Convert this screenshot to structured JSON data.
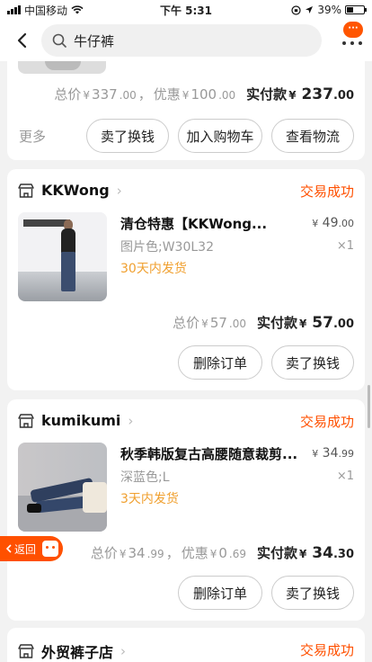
{
  "status_bar": {
    "carrier": "中国移动",
    "time": "下午 5:31",
    "battery": "39%"
  },
  "search": {
    "query": "牛仔裤"
  },
  "order1": {
    "summary": {
      "total_label": "总价",
      "currency": "¥",
      "total_int": "337",
      "total_dec": ".00",
      "discount_label": "优惠",
      "discount_int": "100",
      "discount_dec": ".00",
      "pay_label": "实付款",
      "pay_int": "237",
      "pay_dec": ".00"
    },
    "more": "更多",
    "buttons": {
      "sell": "卖了换钱",
      "cart": "加入购物车",
      "logistics": "查看物流"
    }
  },
  "order2": {
    "shop": "KKWong",
    "status": "交易成功",
    "item": {
      "title": "清仓特惠【KKWong...",
      "price_int": "49",
      "price_dec": ".00",
      "spec": "图片色;W30L32",
      "qty": "×1",
      "ship": "30天内发货"
    },
    "summary": {
      "total_label": "总价",
      "currency": "¥",
      "total_int": "57",
      "total_dec": ".00",
      "pay_label": "实付款",
      "pay_int": "57",
      "pay_dec": ".00"
    },
    "buttons": {
      "delete": "删除订单",
      "sell": "卖了换钱"
    }
  },
  "order3": {
    "shop": "kumikumi",
    "status": "交易成功",
    "item": {
      "title": "秋季韩版复古高腰随意裁剪...",
      "price_int": "34",
      "price_dec": ".99",
      "spec": "深蓝色;L",
      "qty": "×1",
      "ship": "3天内发货"
    },
    "summary": {
      "total_label": "总价",
      "currency": "¥",
      "total_int": "34",
      "total_dec": ".99",
      "discount_label": "优惠",
      "discount_int": "0",
      "discount_dec": ".69",
      "pay_label": "实付款",
      "pay_int": "34",
      "pay_dec": ".30"
    },
    "buttons": {
      "delete": "删除订单",
      "sell": "卖了换钱"
    }
  },
  "order4": {
    "shop": "外贸裤子店",
    "status": "交易成功"
  },
  "float": {
    "return": "返回"
  },
  "more_badge": "···",
  "colors": {
    "accent": "#ff5000",
    "ship": "#f0a030"
  }
}
